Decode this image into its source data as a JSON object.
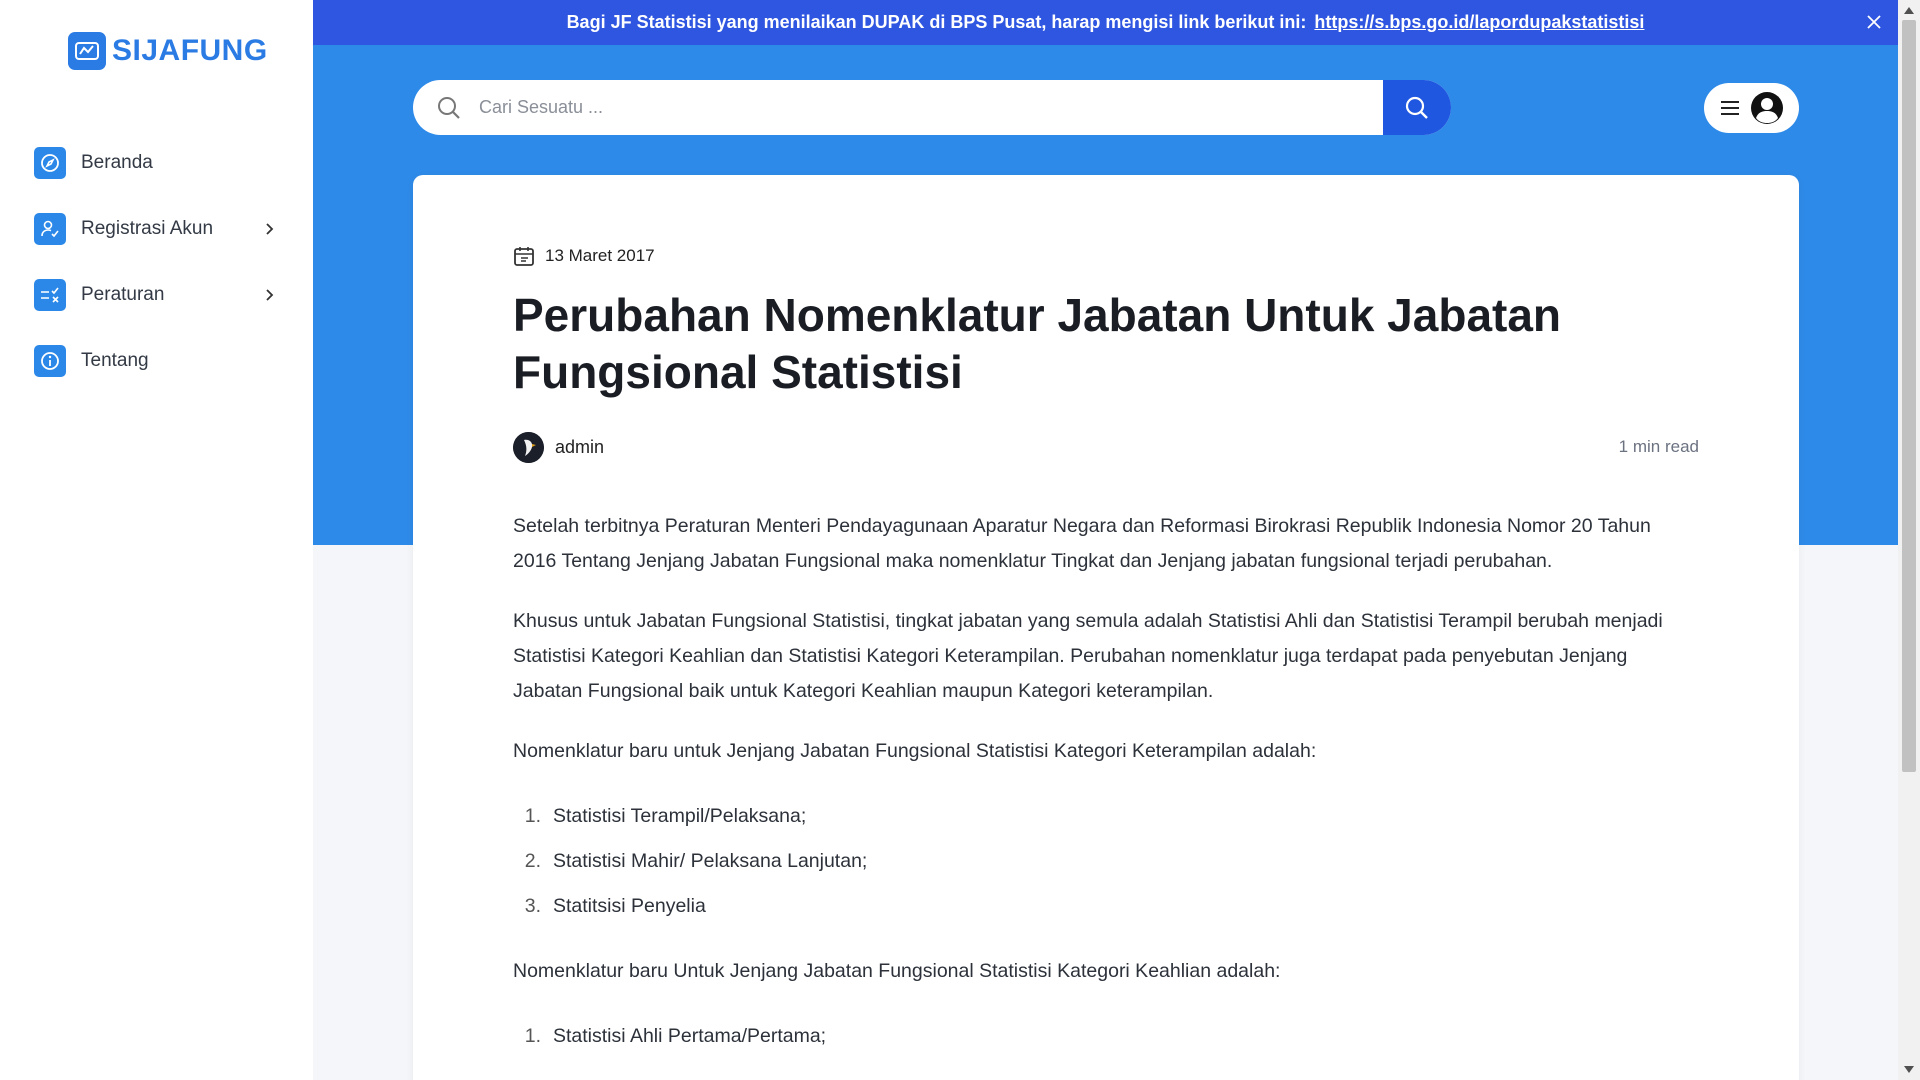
{
  "app": {
    "logo_text": "SIJAFUNG"
  },
  "sidebar": {
    "items": [
      {
        "label": "Beranda",
        "icon": "compass-icon"
      },
      {
        "label": "Registrasi Akun",
        "icon": "user-check-icon",
        "has_submenu": true
      },
      {
        "label": "Peraturan",
        "icon": "checklist-icon",
        "has_submenu": true
      },
      {
        "label": "Tentang",
        "icon": "info-icon"
      }
    ]
  },
  "notice": {
    "text": "Bagi JF Statistisi yang menilaikan DUPAK di BPS Pusat, harap mengisi link berikut ini:",
    "link": "https://s.bps.go.id/lapordupakstatistisi"
  },
  "search": {
    "placeholder": "Cari Sesuatu ..."
  },
  "article": {
    "date": "13 Maret 2017",
    "title": "Perubahan Nomenklatur Jabatan Untuk Jabatan Fungsional Statistisi",
    "author": "admin",
    "read_time": "1 min read",
    "paragraphs": [
      "Setelah terbitnya Peraturan Menteri Pendayagunaan Aparatur Negara dan Reformasi Birokrasi Republik Indonesia Nomor 20 Tahun 2016 Tentang Jenjang Jabatan Fungsional maka nomenklatur Tingkat dan Jenjang jabatan fungsional terjadi perubahan.",
      "Khusus untuk Jabatan Fungsional Statistisi, tingkat jabatan yang semula adalah Statistisi Ahli dan Statistisi Terampil berubah menjadi Statistisi Kategori Keahlian dan Statistisi Kategori Keterampilan. Perubahan nomenklatur juga terdapat pada penyebutan Jenjang Jabatan Fungsional baik untuk Kategori Keahlian maupun Kategori keterampilan.",
      "Nomenklatur baru untuk Jenjang Jabatan Fungsional Statistisi Kategori Keterampilan adalah:",
      "Nomenklatur baru Untuk Jenjang Jabatan Fungsional Statistisi Kategori Keahlian adalah:"
    ],
    "list_keterampilan": [
      {
        "num": "1.",
        "text": "Statistisi Terampil/Pelaksana;"
      },
      {
        "num": "2.",
        "text": "Statistisi Mahir/ Pelaksana Lanjutan;"
      },
      {
        "num": "3.",
        "text": "Statitsisi Penyelia"
      }
    ],
    "list_keahlian": [
      {
        "num": "1.",
        "text": "Statistisi Ahli Pertama/Pertama;"
      }
    ]
  }
}
